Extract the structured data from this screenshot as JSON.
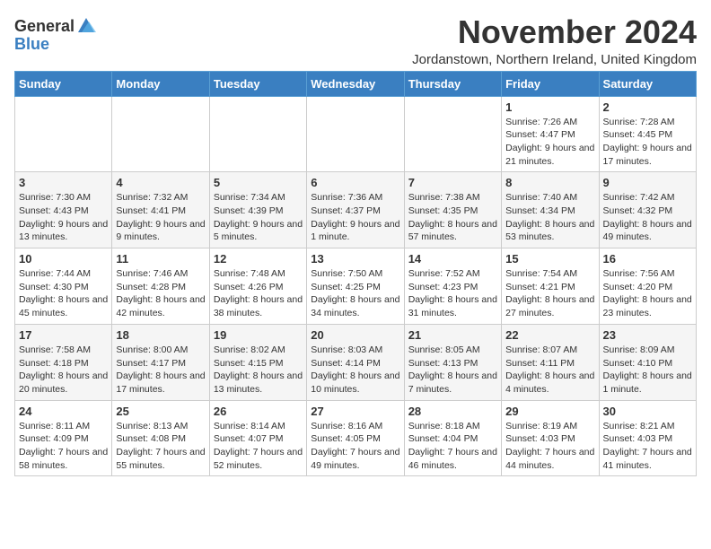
{
  "logo": {
    "general": "General",
    "blue": "Blue"
  },
  "title": "November 2024",
  "subtitle": "Jordanstown, Northern Ireland, United Kingdom",
  "calendar": {
    "headers": [
      "Sunday",
      "Monday",
      "Tuesday",
      "Wednesday",
      "Thursday",
      "Friday",
      "Saturday"
    ],
    "weeks": [
      {
        "days": [
          {
            "date": "",
            "info": ""
          },
          {
            "date": "",
            "info": ""
          },
          {
            "date": "",
            "info": ""
          },
          {
            "date": "",
            "info": ""
          },
          {
            "date": "",
            "info": ""
          },
          {
            "date": "1",
            "info": "Sunrise: 7:26 AM\nSunset: 4:47 PM\nDaylight: 9 hours and 21 minutes."
          },
          {
            "date": "2",
            "info": "Sunrise: 7:28 AM\nSunset: 4:45 PM\nDaylight: 9 hours and 17 minutes."
          }
        ]
      },
      {
        "days": [
          {
            "date": "3",
            "info": "Sunrise: 7:30 AM\nSunset: 4:43 PM\nDaylight: 9 hours and 13 minutes."
          },
          {
            "date": "4",
            "info": "Sunrise: 7:32 AM\nSunset: 4:41 PM\nDaylight: 9 hours and 9 minutes."
          },
          {
            "date": "5",
            "info": "Sunrise: 7:34 AM\nSunset: 4:39 PM\nDaylight: 9 hours and 5 minutes."
          },
          {
            "date": "6",
            "info": "Sunrise: 7:36 AM\nSunset: 4:37 PM\nDaylight: 9 hours and 1 minute."
          },
          {
            "date": "7",
            "info": "Sunrise: 7:38 AM\nSunset: 4:35 PM\nDaylight: 8 hours and 57 minutes."
          },
          {
            "date": "8",
            "info": "Sunrise: 7:40 AM\nSunset: 4:34 PM\nDaylight: 8 hours and 53 minutes."
          },
          {
            "date": "9",
            "info": "Sunrise: 7:42 AM\nSunset: 4:32 PM\nDaylight: 8 hours and 49 minutes."
          }
        ]
      },
      {
        "days": [
          {
            "date": "10",
            "info": "Sunrise: 7:44 AM\nSunset: 4:30 PM\nDaylight: 8 hours and 45 minutes."
          },
          {
            "date": "11",
            "info": "Sunrise: 7:46 AM\nSunset: 4:28 PM\nDaylight: 8 hours and 42 minutes."
          },
          {
            "date": "12",
            "info": "Sunrise: 7:48 AM\nSunset: 4:26 PM\nDaylight: 8 hours and 38 minutes."
          },
          {
            "date": "13",
            "info": "Sunrise: 7:50 AM\nSunset: 4:25 PM\nDaylight: 8 hours and 34 minutes."
          },
          {
            "date": "14",
            "info": "Sunrise: 7:52 AM\nSunset: 4:23 PM\nDaylight: 8 hours and 31 minutes."
          },
          {
            "date": "15",
            "info": "Sunrise: 7:54 AM\nSunset: 4:21 PM\nDaylight: 8 hours and 27 minutes."
          },
          {
            "date": "16",
            "info": "Sunrise: 7:56 AM\nSunset: 4:20 PM\nDaylight: 8 hours and 23 minutes."
          }
        ]
      },
      {
        "days": [
          {
            "date": "17",
            "info": "Sunrise: 7:58 AM\nSunset: 4:18 PM\nDaylight: 8 hours and 20 minutes."
          },
          {
            "date": "18",
            "info": "Sunrise: 8:00 AM\nSunset: 4:17 PM\nDaylight: 8 hours and 17 minutes."
          },
          {
            "date": "19",
            "info": "Sunrise: 8:02 AM\nSunset: 4:15 PM\nDaylight: 8 hours and 13 minutes."
          },
          {
            "date": "20",
            "info": "Sunrise: 8:03 AM\nSunset: 4:14 PM\nDaylight: 8 hours and 10 minutes."
          },
          {
            "date": "21",
            "info": "Sunrise: 8:05 AM\nSunset: 4:13 PM\nDaylight: 8 hours and 7 minutes."
          },
          {
            "date": "22",
            "info": "Sunrise: 8:07 AM\nSunset: 4:11 PM\nDaylight: 8 hours and 4 minutes."
          },
          {
            "date": "23",
            "info": "Sunrise: 8:09 AM\nSunset: 4:10 PM\nDaylight: 8 hours and 1 minute."
          }
        ]
      },
      {
        "days": [
          {
            "date": "24",
            "info": "Sunrise: 8:11 AM\nSunset: 4:09 PM\nDaylight: 7 hours and 58 minutes."
          },
          {
            "date": "25",
            "info": "Sunrise: 8:13 AM\nSunset: 4:08 PM\nDaylight: 7 hours and 55 minutes."
          },
          {
            "date": "26",
            "info": "Sunrise: 8:14 AM\nSunset: 4:07 PM\nDaylight: 7 hours and 52 minutes."
          },
          {
            "date": "27",
            "info": "Sunrise: 8:16 AM\nSunset: 4:05 PM\nDaylight: 7 hours and 49 minutes."
          },
          {
            "date": "28",
            "info": "Sunrise: 8:18 AM\nSunset: 4:04 PM\nDaylight: 7 hours and 46 minutes."
          },
          {
            "date": "29",
            "info": "Sunrise: 8:19 AM\nSunset: 4:03 PM\nDaylight: 7 hours and 44 minutes."
          },
          {
            "date": "30",
            "info": "Sunrise: 8:21 AM\nSunset: 4:03 PM\nDaylight: 7 hours and 41 minutes."
          }
        ]
      }
    ]
  }
}
